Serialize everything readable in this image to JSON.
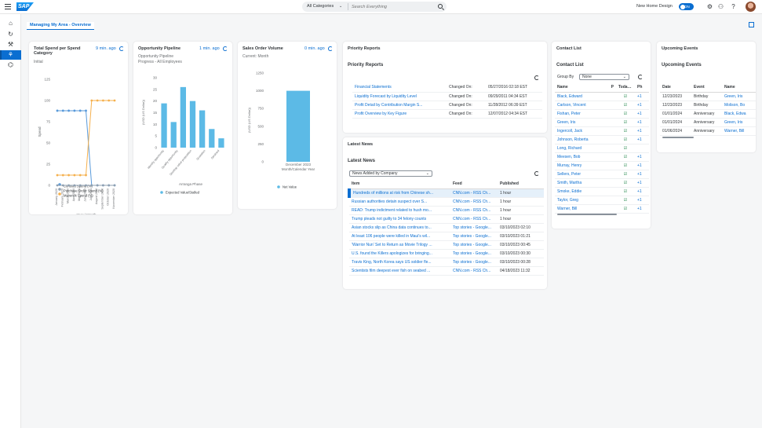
{
  "shell": {
    "logo": "SAP",
    "search_category": "All Categories",
    "search_placeholder": "Search Everything",
    "new_home_label": "New Home Design",
    "toggle_label": "ON"
  },
  "page": {
    "title": "Managing My Area - Overview"
  },
  "spend_card": {
    "title": "Total Spend per Spend Category",
    "subtitle": "Initial",
    "refresh_text": "9 min. ago",
    "chart_data": {
      "type": "line",
      "ylabel": "Spend",
      "xlabel": "Year / Month",
      "ylim": [
        0,
        125
      ],
      "yticks": [
        "125",
        "100",
        "75",
        "50",
        "25",
        "0"
      ],
      "categories": [
        "January 2020",
        "February 2020",
        "March 2020",
        "April 2020",
        "May 2020",
        "June 2020",
        "July 2020",
        "August 2020",
        "September 2020",
        "October 2020",
        "November 2020"
      ],
      "series": [
        {
          "name": "Contract Spend (%)",
          "color": "#5899da",
          "values": [
            88,
            88,
            88,
            88,
            88,
            88,
            0,
            0,
            0,
            0,
            0
          ]
        },
        {
          "name": "Purchase Order Spend (%)",
          "color": "#8fa0b1",
          "values": [
            0,
            0,
            0,
            0,
            0,
            0,
            0,
            0,
            0,
            0,
            0
          ]
        },
        {
          "name": "Maverick Spend (%)",
          "color": "#f5b04d",
          "values": [
            12,
            12,
            12,
            12,
            12,
            12,
            100,
            100,
            100,
            100,
            100
          ]
        }
      ]
    }
  },
  "pipeline_card": {
    "title": "Opportunity Pipeline",
    "subtitle1": "Opportunity Pipeline",
    "subtitle2": "Progress - All Employees",
    "refresh_text": "1 min. ago",
    "chart_data": {
      "type": "bar",
      "ylabel": "(USD (US Dollar))",
      "xlabel": "Arranga Phase",
      "ylim": [
        0,
        30
      ],
      "yticks": [
        "30",
        "25",
        "20",
        "15",
        "10",
        "5",
        "0"
      ],
      "categories": [
        "Identify opportunity",
        "Quality opportunity",
        "Develop value proposition",
        "Quotation",
        "Declined"
      ],
      "series": [
        {
          "name": "Expected Value/Stalled",
          "color": "#5cbae6",
          "values": [
            19,
            11,
            26,
            20,
            16,
            8,
            4
          ]
        }
      ],
      "bar_labels_shown": 5
    }
  },
  "sales_card": {
    "title": "Sales Order Volume",
    "subtitle": "Current: Month",
    "refresh_text": "0 min. ago",
    "chart_data": {
      "type": "bar",
      "ylabel": "(USD (US Dollar))",
      "xlabel": "Month/Calendar Year",
      "ylim": [
        0,
        1250
      ],
      "yticks": [
        "1250",
        "1000",
        "750",
        "500",
        "250",
        "0"
      ],
      "categories": [
        "December 2023"
      ],
      "series": [
        {
          "name": "Net Value",
          "color": "#5cbae6",
          "values": [
            1000
          ]
        }
      ]
    }
  },
  "priority_card": {
    "header": "Priority Reports",
    "title": "Priority Reports",
    "rows": [
      {
        "name": "Financial Statements",
        "label": "Changed On:",
        "date": "05/27/2016 02:18 EST"
      },
      {
        "name": "Liquidity Forecast by Liquidity Level",
        "label": "Changed On:",
        "date": "09/29/2011 04:34 EST"
      },
      {
        "name": "Profit Detail by Contribution Margin S...",
        "label": "Changed On:",
        "date": "11/28/2012 06:39 EST"
      },
      {
        "name": "Profit Overview by Key Figure",
        "label": "Changed On:",
        "date": "12/07/2012 04:34 EST"
      }
    ]
  },
  "news_card": {
    "header": "Latest News",
    "title": "Latest News",
    "filter": "News Added by Company",
    "columns": [
      "Item",
      "Feed",
      "Published"
    ],
    "rows": [
      {
        "item": "Hundreds of millions at risk from Chinese sh...",
        "feed": "CNN.com - RSS Ch...",
        "published": "1 hour"
      },
      {
        "item": "Russian authorities detain suspect over S...",
        "feed": "CNN.com - RSS Ch...",
        "published": "1 hour"
      },
      {
        "item": "READ: Trump indictment related to hush mo...",
        "feed": "CNN.com - RSS Ch...",
        "published": "1 hour"
      },
      {
        "item": "Trump pleads not guilty to 34 felony counts",
        "feed": "CNN.com - RSS Ch...",
        "published": "1 hour"
      },
      {
        "item": "Asian stocks slip as China data continues to...",
        "feed": "Top stories - Google...",
        "published": "03/10/2023 02:10"
      },
      {
        "item": "At least 106 people were killed in Maui's wil...",
        "feed": "Top stories - Google...",
        "published": "03/10/2023 01:21"
      },
      {
        "item": "'Warrior Nun' Set to Return as Movie Trilogy ...",
        "feed": "Top stories - Google...",
        "published": "03/10/2023 00:45"
      },
      {
        "item": "U.S. found the Killers apologizes for bringing...",
        "feed": "Top stories - Google...",
        "published": "03/10/2023 00:30"
      },
      {
        "item": "Travis King, North Korea says US soldier fle...",
        "feed": "Top stories - Google...",
        "published": "03/10/2023 00:28"
      },
      {
        "item": "Scientists film deepest ever fish on seabed ...",
        "feed": "CNN.com - RSS Ch...",
        "published": "04/18/2023 11:32"
      }
    ]
  },
  "contact_card": {
    "header": "Contact List",
    "title": "Contact List",
    "group_by_label": "Group By",
    "group_by_value": "None",
    "columns": [
      "Name",
      "P",
      "Today'...",
      "Ph"
    ],
    "rows": [
      {
        "name": "Black, Edward",
        "plus": "+1"
      },
      {
        "name": "Carlson, Vincent",
        "plus": "+1"
      },
      {
        "name": "Fishan, Peter",
        "plus": "+1"
      },
      {
        "name": "Green, Iris",
        "plus": "+1"
      },
      {
        "name": "Ingercoll, Jack",
        "plus": "+1"
      },
      {
        "name": "Johnson, Roberta",
        "plus": "+1"
      },
      {
        "name": "Long, Richard",
        "plus": ""
      },
      {
        "name": "Meesen, Bob",
        "plus": "+1"
      },
      {
        "name": "Murray, Henry",
        "plus": "+1"
      },
      {
        "name": "Sellers, Peter",
        "plus": "+1"
      },
      {
        "name": "Smith, Martha",
        "plus": "+1"
      },
      {
        "name": "Smoke, Eddie",
        "plus": "+1"
      },
      {
        "name": "Taylor, Greg",
        "plus": "+1"
      },
      {
        "name": "Warner, Bill",
        "plus": "+1"
      }
    ]
  },
  "events_card": {
    "header": "Upcoming Events",
    "title": "Upcoming Events",
    "columns": [
      "Date",
      "Event",
      "Name"
    ],
    "rows": [
      {
        "date": "12/23/2023",
        "event": "Birthday",
        "name": "Green, Iris"
      },
      {
        "date": "12/23/2023",
        "event": "Birthday",
        "name": "Molison, Bo"
      },
      {
        "date": "01/01/2024",
        "event": "Anniversary",
        "name": "Black, Edwa"
      },
      {
        "date": "01/01/2024",
        "event": "Anniversary",
        "name": "Green, Iris"
      },
      {
        "date": "01/06/2024",
        "event": "Anniversary",
        "name": "Warner, Bill"
      }
    ]
  }
}
